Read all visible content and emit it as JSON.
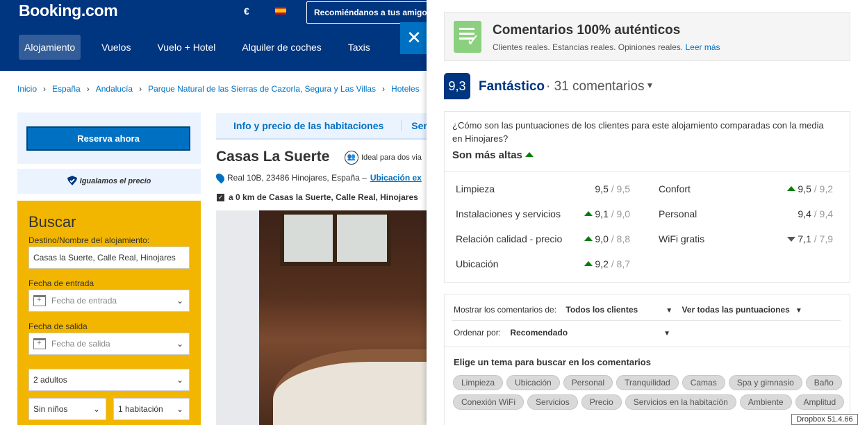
{
  "header": {
    "logo_main": "Booking",
    "logo_dot": ".com",
    "currency": "€",
    "recommend_label": "Recomiéndanos a tus amigos",
    "nav": [
      "Alojamiento",
      "Vuelos",
      "Vuelo + Hotel",
      "Alquiler de coches",
      "Taxis"
    ]
  },
  "breadcrumb": [
    "Inicio",
    "España",
    "Andalucía",
    "Parque Natural de las Sierras de Cazorla, Segura y Las Villas",
    "Hoteles"
  ],
  "sidebar": {
    "reserve_label": "Reserva ahora",
    "price_match_label": "Igualamos el precio",
    "search": {
      "title": "Buscar",
      "destination_label": "Destino/Nombre del alojamiento:",
      "destination_value": "Casas la Suerte, Calle Real, Hinojares",
      "checkin_label": "Fecha de entrada",
      "checkin_placeholder": "Fecha de entrada",
      "checkout_label": "Fecha de salida",
      "checkout_placeholder": "Fecha de salida",
      "adults": "2 adultos",
      "children": "Sin niños",
      "rooms": "1 habitación"
    }
  },
  "main": {
    "tabs": [
      "Info y precio de las habitaciones",
      "Serv"
    ],
    "hotel_name": "Casas La Suerte",
    "ideal_text": "Ideal para dos via",
    "address": "Real 10B, 23486 Hinojares, España –",
    "location_link": "Ubicación ex",
    "distance": "a 0 km de Casas la Suerte, Calle Real, Hinojares"
  },
  "reviews": {
    "auth_title": "Comentarios 100% auténticos",
    "auth_sub": "Clientes reales. Estancias reales. Opiniones reales.",
    "auth_link": "Leer más",
    "score": "9,3",
    "score_word": "Fantástico",
    "score_count": "· 31 comentarios",
    "compare_question": "¿Cómo son las puntuaciones de los clientes para este alojamiento comparadas con la media en Hinojares?",
    "compare_answer": "Son más altas",
    "categories": [
      {
        "name": "Limpieza",
        "score": "9,5",
        "avg": "/ 9,5",
        "trend": "none"
      },
      {
        "name": "Confort",
        "score": "9,5",
        "avg": "/ 9,2",
        "trend": "up"
      },
      {
        "name": "Instalaciones y servicios",
        "score": "9,1",
        "avg": "/ 9,0",
        "trend": "up"
      },
      {
        "name": "Personal",
        "score": "9,4",
        "avg": "/ 9,4",
        "trend": "none"
      },
      {
        "name": "Relación calidad - precio",
        "score": "9,0",
        "avg": "/ 8,8",
        "trend": "up"
      },
      {
        "name": "WiFi gratis",
        "score": "7,1",
        "avg": "/ 7,9",
        "trend": "down"
      },
      {
        "name": "Ubicación",
        "score": "9,2",
        "avg": "/ 8,7",
        "trend": "up"
      }
    ],
    "filters": {
      "show_label": "Mostrar los comentarios de:",
      "show_value": "Todos los clientes",
      "scores_value": "Ver todas las puntuaciones",
      "sort_label": "Ordenar por:",
      "sort_value": "Recomendado"
    },
    "topics_title": "Elige un tema para buscar en los comentarios",
    "topics": [
      "Limpieza",
      "Ubicación",
      "Personal",
      "Tranquilidad",
      "Camas",
      "Spa y gimnasio",
      "Baño",
      "Conexión WiFi",
      "Servicios",
      "Precio",
      "Servicios en la habitación",
      "Ambiente",
      "Amplitud"
    ]
  },
  "tooltip": "Dropbox 51.4.66",
  "colors": {
    "brand": "#003580",
    "link": "#0071c2",
    "up": "#008009",
    "search_bg": "#f2b600"
  }
}
